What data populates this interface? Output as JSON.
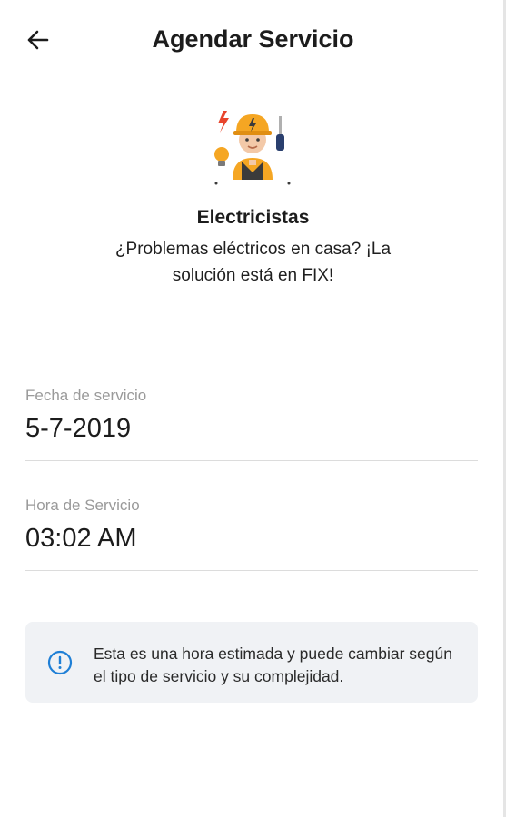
{
  "header": {
    "title": "Agendar Servicio",
    "back_icon": "arrow-left-icon"
  },
  "service": {
    "icon": "electrician-icon",
    "name": "Electricistas",
    "description": "¿Problemas eléctricos en casa? ¡La solución está en FIX!"
  },
  "form": {
    "date_label": "Fecha de servicio",
    "date_value": "5-7-2019",
    "time_label": "Hora de Servicio",
    "time_value": "03:02 AM"
  },
  "notice": {
    "icon": "info-icon",
    "text": "Esta es una hora estimada y puede cambiar según el tipo de servicio y su complejidad."
  },
  "colors": {
    "accent": "#1e7fd6",
    "helmet": "#f5a623",
    "notice_bg": "#f0f2f5"
  }
}
